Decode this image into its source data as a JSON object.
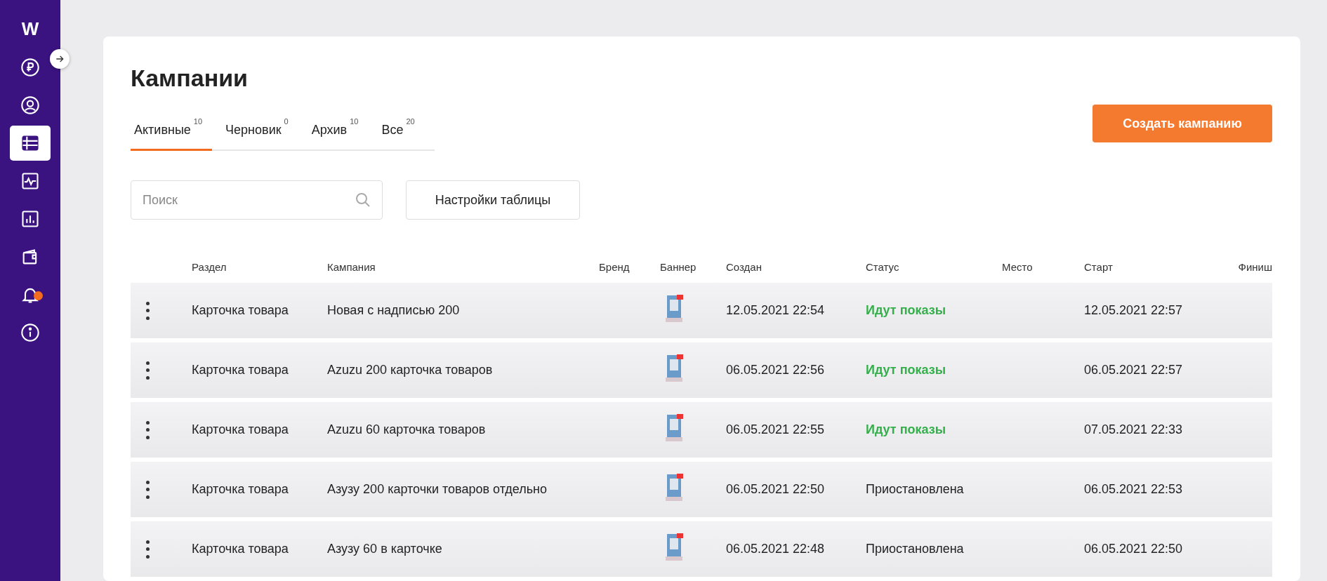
{
  "sidebar": {
    "logo": "W",
    "items": [
      {
        "kind": "ruble",
        "selected": false,
        "has_dot": false
      },
      {
        "kind": "user",
        "selected": false,
        "has_dot": false
      },
      {
        "kind": "list",
        "selected": true,
        "has_dot": false
      },
      {
        "kind": "activity",
        "selected": false,
        "has_dot": false
      },
      {
        "kind": "chart",
        "selected": false,
        "has_dot": false
      },
      {
        "kind": "wallet",
        "selected": false,
        "has_dot": false
      },
      {
        "kind": "bell",
        "selected": false,
        "has_dot": true
      },
      {
        "kind": "info",
        "selected": false,
        "has_dot": false
      }
    ]
  },
  "page": {
    "title": "Кампании",
    "tabs": [
      {
        "label": "Активные",
        "count": "10",
        "selected": true
      },
      {
        "label": "Черновик",
        "count": "0",
        "selected": false
      },
      {
        "label": "Архив",
        "count": "10",
        "selected": false
      },
      {
        "label": "Все",
        "count": "20",
        "selected": false
      }
    ],
    "create_button": "Создать кампанию",
    "search": {
      "placeholder": "Поиск"
    },
    "settings_button": "Настройки таблицы",
    "table": {
      "columns": [
        "Раздел",
        "Кампания",
        "Бренд",
        "Баннер",
        "Создан",
        "Статус",
        "Место",
        "Старт",
        "Финиш"
      ],
      "rows": [
        {
          "section": "Карточка товара",
          "campaign": "Новая с надписью 200",
          "created": "12.05.2021 22:54",
          "status": "Идут показы",
          "kind": "active",
          "start": "12.05.2021 22:57"
        },
        {
          "section": "Карточка товара",
          "campaign": "Azuzu 200 карточка товаров",
          "created": "06.05.2021 22:56",
          "status": "Идут показы",
          "kind": "active",
          "start": "06.05.2021 22:57"
        },
        {
          "section": "Карточка товара",
          "campaign": "Azuzu 60 карточка товаров",
          "created": "06.05.2021 22:55",
          "status": "Идут показы",
          "kind": "active",
          "start": "07.05.2021 22:33"
        },
        {
          "section": "Карточка товара",
          "campaign": "Азузу 200 карточки товаров отдельно",
          "created": "06.05.2021 22:50",
          "status": "Приостановлена",
          "kind": "paused",
          "start": "06.05.2021 22:53"
        },
        {
          "section": "Карточка товара",
          "campaign": "Азузу 60 в карточке",
          "created": "06.05.2021 22:48",
          "status": "Приостановлена",
          "kind": "paused",
          "start": "06.05.2021 22:50"
        }
      ]
    }
  }
}
